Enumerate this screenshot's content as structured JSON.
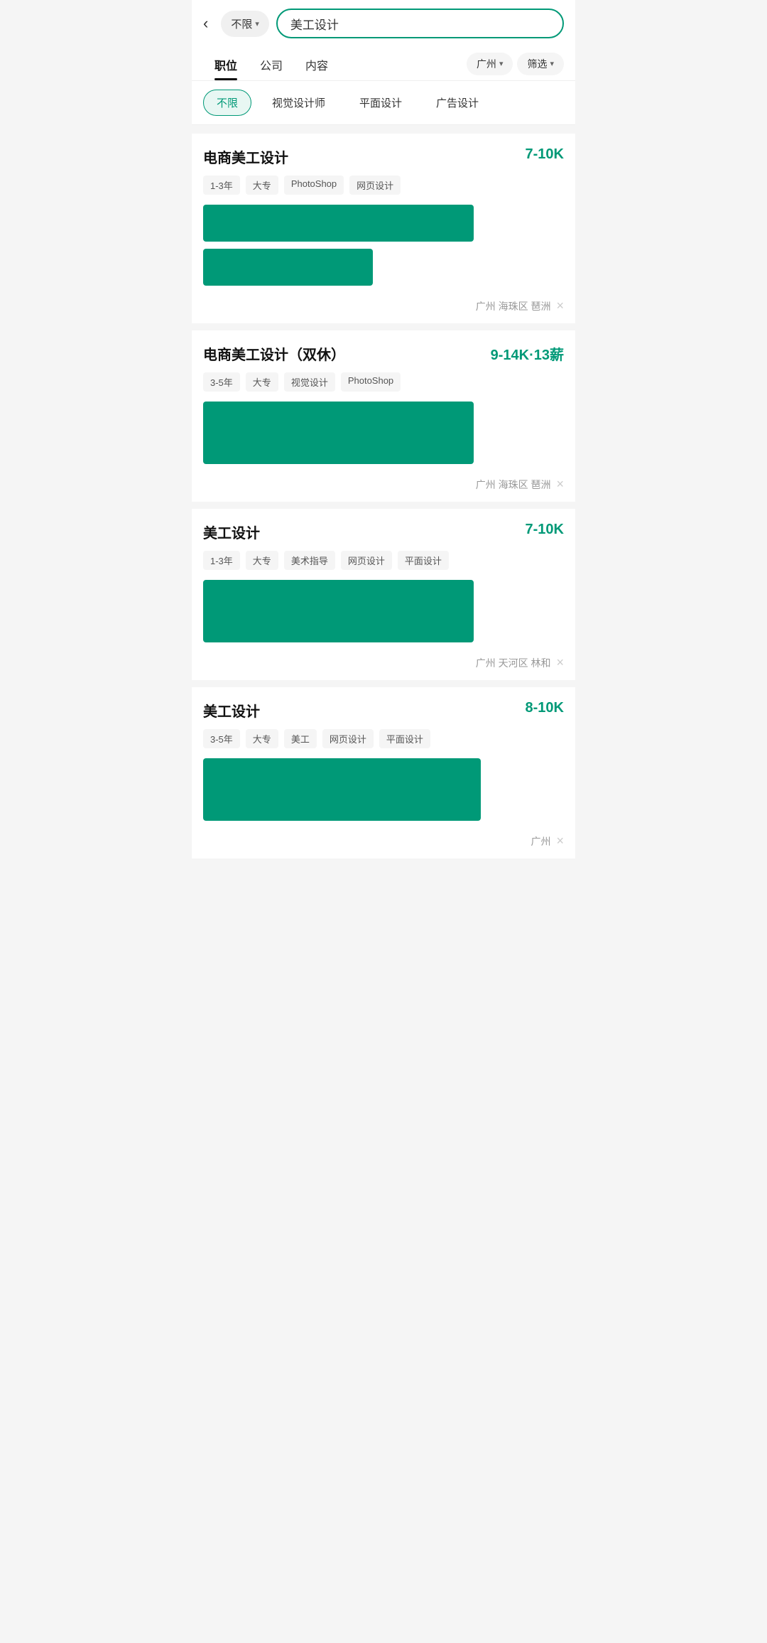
{
  "header": {
    "back_label": "‹",
    "location_label": "不限",
    "location_arrow": "▾",
    "search_value": "美工设计",
    "search_btn_label": ""
  },
  "tabs": {
    "items": [
      {
        "label": "职位",
        "active": true
      },
      {
        "label": "公司",
        "active": false
      },
      {
        "label": "内容",
        "active": false
      }
    ],
    "city_label": "广州",
    "city_arrow": "▾",
    "filter_label": "筛选",
    "filter_arrow": "▾"
  },
  "categories": [
    {
      "label": "不限",
      "active": true
    },
    {
      "label": "视觉设计师",
      "active": false
    },
    {
      "label": "平面设计",
      "active": false
    },
    {
      "label": "广告设计",
      "active": false
    }
  ],
  "jobs": [
    {
      "title": "电商美工设计",
      "salary": "7-10K",
      "tags": [
        "1-3年",
        "大专",
        "PhotoShop",
        "网页设计"
      ],
      "location": "广州  海珠区  琶洲",
      "company_block_class": "company-block",
      "company_block2_class": "company-block2"
    },
    {
      "title": "电商美工设计（双休）",
      "salary": "9-14K·13薪",
      "tags": [
        "3-5年",
        "大专",
        "视觉设计",
        "PhotoShop"
      ],
      "location": "广州  海珠区  琶洲",
      "company_block_class": "company-block3"
    },
    {
      "title": "美工设计",
      "salary": "7-10K",
      "tags": [
        "1-3年",
        "大专",
        "美术指导",
        "网页设计",
        "平面设计"
      ],
      "location": "广州  天河区  林和",
      "company_block_class": "company-block3"
    },
    {
      "title": "美工设计",
      "salary": "8-10K",
      "tags": [
        "3-5年",
        "大专",
        "美工",
        "网页设计",
        "平面设计"
      ],
      "location": "广州",
      "company_block_class": "company-block4"
    }
  ],
  "close_icon": "×"
}
